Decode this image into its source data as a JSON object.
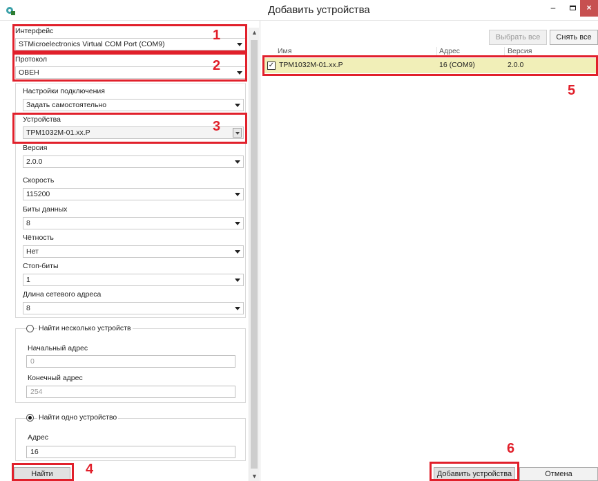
{
  "window": {
    "title": "Добавить устройства",
    "controls": {
      "minimize": "–",
      "close": "×"
    }
  },
  "left": {
    "interface": {
      "label": "Интерфейс",
      "value": "STMicroelectronics Virtual COM Port (COM9)"
    },
    "protocol": {
      "label": "Протокол",
      "value": "ОВЕН"
    },
    "connection": {
      "label": "Настройки подключения",
      "value": "Задать самостоятельно"
    },
    "devices": {
      "label": "Устройства",
      "value": "ТРМ1032М-01.хх.Р"
    },
    "version": {
      "label": "Версия",
      "value": "2.0.0"
    },
    "speed": {
      "label": "Скорость",
      "value": "115200"
    },
    "data_bits": {
      "label": "Биты данных",
      "value": "8"
    },
    "parity": {
      "label": "Чётность",
      "value": "Нет"
    },
    "stop_bits": {
      "label": "Стоп-биты",
      "value": "1"
    },
    "addr_len": {
      "label": "Длина сетевого адреса",
      "value": "8"
    },
    "find_many": {
      "label": "Найти несколько устройств",
      "start_label": "Начальный адрес",
      "start_value": "0",
      "end_label": "Конечный адрес",
      "end_value": "254"
    },
    "find_one": {
      "label": "Найти одно устройство",
      "addr_label": "Адрес",
      "addr_value": "16"
    },
    "find_button": "Найти"
  },
  "right": {
    "select_all": "Выбрать все",
    "deselect_all": "Снять все",
    "columns": [
      "Имя",
      "Адрес",
      "Версия"
    ],
    "rows": [
      {
        "checked": "✓",
        "name": "ТРМ1032М-01.хх.Р",
        "address": "16 (COM9)",
        "version": "2.0.0"
      }
    ],
    "add_button": "Добавить устройства",
    "cancel_button": "Отмена"
  },
  "callouts": [
    "1",
    "2",
    "3",
    "4",
    "5",
    "6"
  ],
  "colors": {
    "callout": "#e1202b",
    "selected_row": "#f1efb8",
    "close_button": "#c75050"
  },
  "icons": {
    "app": "gear-icon",
    "dropdown": "chevron-down-icon"
  }
}
